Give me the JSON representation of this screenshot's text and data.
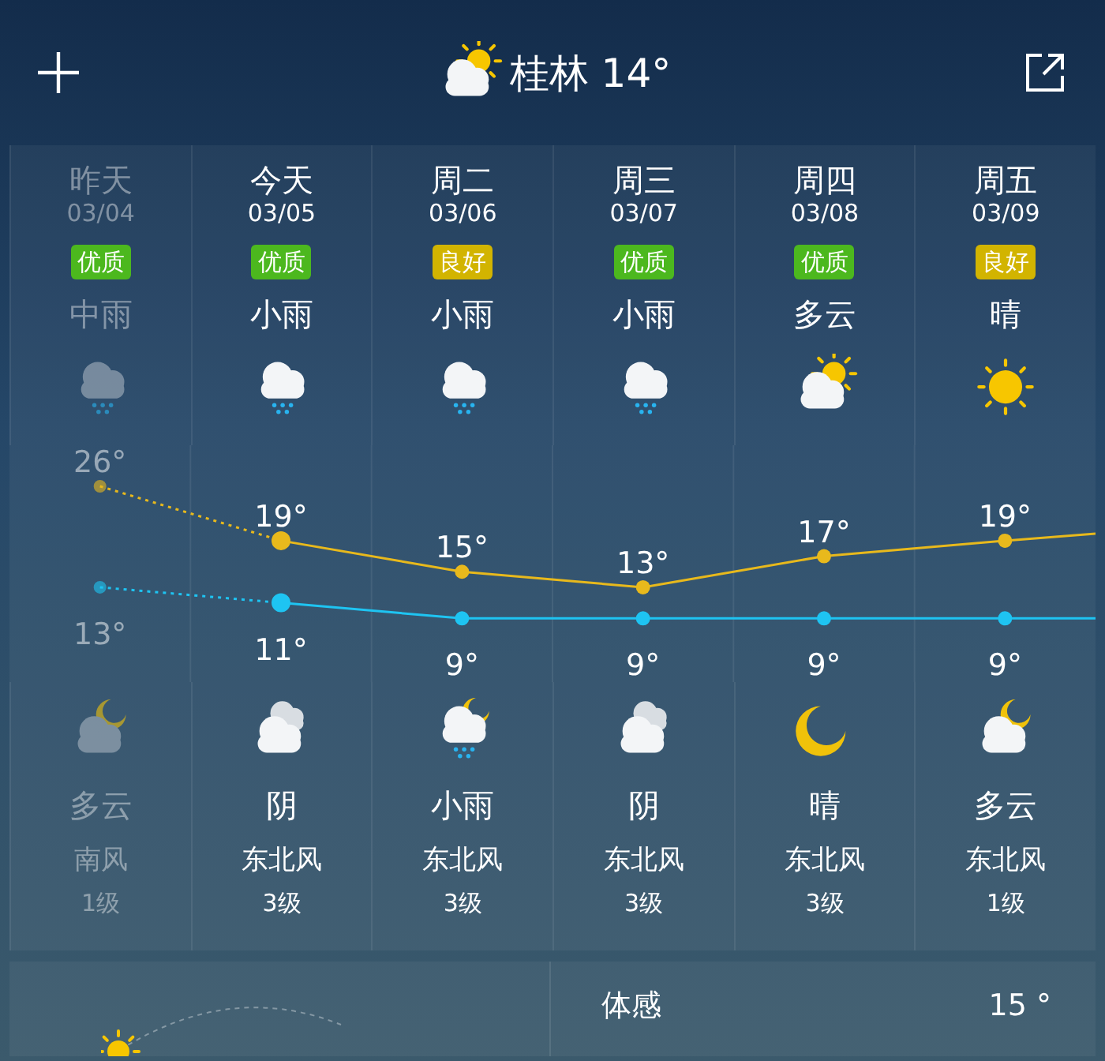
{
  "header": {
    "title": "桂林 14°",
    "icon": {
      "kind": "partly_cloudy"
    }
  },
  "forecast": {
    "days": [
      {
        "day": "昨天",
        "date": "03/04",
        "past": true,
        "today": false,
        "aqi": {
          "label": "优质",
          "color": "#4cb81e"
        },
        "day_condition": "中雨",
        "day_icon": {
          "kind": "rain"
        },
        "night_icon": {
          "kind": "night_cloudy"
        },
        "night_condition": "多云",
        "wind_direction": "南风",
        "wind_level": "1级"
      },
      {
        "day": "今天",
        "date": "03/05",
        "past": false,
        "today": true,
        "aqi": {
          "label": "优质",
          "color": "#4cb81e"
        },
        "day_condition": "小雨",
        "day_icon": {
          "kind": "rain"
        },
        "night_icon": {
          "kind": "cloudy"
        },
        "night_condition": "阴",
        "wind_direction": "东北风",
        "wind_level": "3级"
      },
      {
        "day": "周二",
        "date": "03/06",
        "past": false,
        "today": false,
        "aqi": {
          "label": "良好",
          "color": "#d2b400"
        },
        "day_condition": "小雨",
        "day_icon": {
          "kind": "rain"
        },
        "night_icon": {
          "kind": "night_rain"
        },
        "night_condition": "小雨",
        "wind_direction": "东北风",
        "wind_level": "3级"
      },
      {
        "day": "周三",
        "date": "03/07",
        "past": false,
        "today": false,
        "aqi": {
          "label": "优质",
          "color": "#4cb81e"
        },
        "day_condition": "小雨",
        "day_icon": {
          "kind": "rain"
        },
        "night_icon": {
          "kind": "cloudy"
        },
        "night_condition": "阴",
        "wind_direction": "东北风",
        "wind_level": "3级"
      },
      {
        "day": "周四",
        "date": "03/08",
        "past": false,
        "today": false,
        "aqi": {
          "label": "优质",
          "color": "#4cb81e"
        },
        "day_condition": "多云",
        "day_icon": {
          "kind": "partly_cloudy"
        },
        "night_icon": {
          "kind": "clear_night"
        },
        "night_condition": "晴",
        "wind_direction": "东北风",
        "wind_level": "3级"
      },
      {
        "day": "周五",
        "date": "03/09",
        "past": false,
        "today": false,
        "aqi": {
          "label": "良好",
          "color": "#d2b400"
        },
        "day_condition": "晴",
        "day_icon": {
          "kind": "sunny"
        },
        "night_icon": {
          "kind": "night_cloudy"
        },
        "night_condition": "多云",
        "wind_direction": "东北风",
        "wind_level": "1级"
      }
    ],
    "chart_data": {
      "type": "line",
      "categories": [
        null,
        null,
        null,
        null,
        null,
        null
      ],
      "data_labels": true,
      "series": [
        {
          "color": "#e8b91c",
          "line_style": "dotted_past",
          "marker": "circle",
          "values": [
            26,
            19,
            15,
            13,
            17,
            19
          ],
          "value_labels": [
            "26°",
            "19°",
            "15°",
            "13°",
            "17°",
            "19°"
          ]
        },
        {
          "color": "#1ec4f2",
          "line_style": "dotted_past",
          "marker": "circle",
          "values": [
            13,
            11,
            9,
            9,
            9,
            9
          ],
          "value_labels": [
            "13°",
            "11°",
            "9°",
            "9°",
            "9°",
            "9°"
          ]
        }
      ]
    }
  },
  "details": {
    "feels_like_label": "体感",
    "feels_like_value": "15 °"
  }
}
